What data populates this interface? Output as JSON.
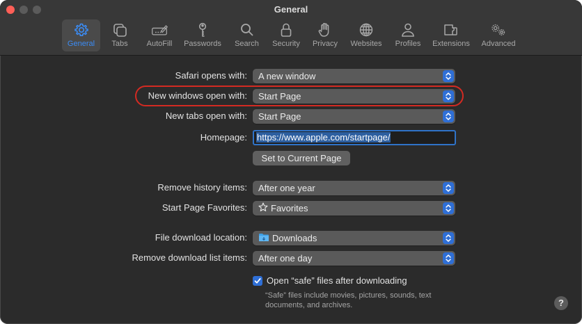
{
  "window": {
    "title": "General"
  },
  "toolbar": {
    "items": [
      {
        "label": "General",
        "icon": "gear-icon"
      },
      {
        "label": "Tabs",
        "icon": "tabs-icon"
      },
      {
        "label": "AutoFill",
        "icon": "pencil-box-icon"
      },
      {
        "label": "Passwords",
        "icon": "key-icon"
      },
      {
        "label": "Search",
        "icon": "magnifier-icon"
      },
      {
        "label": "Security",
        "icon": "lock-icon"
      },
      {
        "label": "Privacy",
        "icon": "hand-icon"
      },
      {
        "label": "Websites",
        "icon": "globe-icon"
      },
      {
        "label": "Profiles",
        "icon": "person-icon"
      },
      {
        "label": "Extensions",
        "icon": "puzzle-icon"
      },
      {
        "label": "Advanced",
        "icon": "gears-icon"
      }
    ],
    "active": "General"
  },
  "settings": {
    "safari_opens_with": {
      "label": "Safari opens with:",
      "value": "A new window"
    },
    "new_windows_open_with": {
      "label": "New windows open with:",
      "value": "Start Page"
    },
    "new_tabs_open_with": {
      "label": "New tabs open with:",
      "value": "Start Page"
    },
    "homepage": {
      "label": "Homepage:",
      "value": "https://www.apple.com/startpage/"
    },
    "set_current_page": {
      "label": "Set to Current Page"
    },
    "remove_history": {
      "label": "Remove history items:",
      "value": "After one year"
    },
    "start_page_favorites": {
      "label": "Start Page Favorites:",
      "value": "Favorites"
    },
    "file_download_location": {
      "label": "File download location:",
      "value": "Downloads"
    },
    "remove_download_list": {
      "label": "Remove download list items:",
      "value": "After one day"
    },
    "open_safe_files": {
      "label": "Open “safe” files after downloading",
      "checked": true,
      "hint": "“Safe” files include movies, pictures, sounds, text documents, and archives."
    }
  },
  "help": {
    "label": "?"
  },
  "colors": {
    "accent": "#2f6fd6",
    "highlight_ring": "#d42a22",
    "active_tab_text": "#3b8cf5"
  }
}
